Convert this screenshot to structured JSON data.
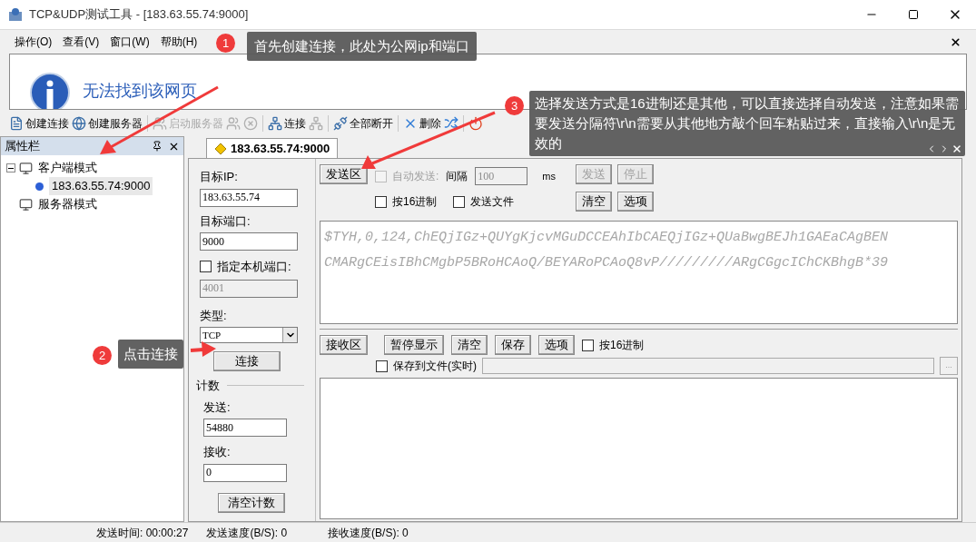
{
  "window": {
    "title": "TCP&UDP测试工具 - [183.63.55.74:9000]"
  },
  "menu": [
    "操作(O)",
    "查看(V)",
    "窗口(W)",
    "帮助(H)"
  ],
  "browser_pane": {
    "message": "无法找到该网页"
  },
  "toolbar": [
    {
      "label": "创建连接",
      "disabled": false
    },
    {
      "label": "创建服务器",
      "disabled": false
    },
    {
      "label": "启动服务器",
      "disabled": true
    },
    {
      "disabled": true
    },
    {
      "disabled": true
    },
    {
      "label": "连接",
      "disabled": false
    },
    {
      "disabled": true
    },
    {
      "label": "全部断开",
      "disabled": false
    },
    {
      "label": "删除",
      "disabled": false
    },
    {
      "disabled": false
    },
    {
      "disabled": false
    }
  ],
  "sidebar": {
    "title": "属性栏",
    "tree": [
      {
        "label": "客户端模式",
        "selected": false,
        "expanded": true,
        "children": [
          {
            "label": "183.63.55.74:9000",
            "selected": true
          }
        ]
      },
      {
        "label": "服务器模式",
        "selected": false
      }
    ]
  },
  "tabs": [
    {
      "label": "183.63.55.74:9000",
      "selected": true
    }
  ],
  "form": [
    {
      "kind": "field",
      "label": "目标IP:",
      "value": "183.63.55.74",
      "disabled": false
    },
    {
      "kind": "field",
      "label": "目标端口:",
      "value": "9000",
      "disabled": false
    },
    {
      "kind": "checkbox",
      "label": "指定本机端口:",
      "checked": false
    },
    {
      "kind": "field",
      "value": "4001",
      "disabled": true
    },
    {
      "kind": "select",
      "label": "类型:",
      "value": "TCP"
    }
  ],
  "connect_button": "连接",
  "counter": {
    "title": "计数",
    "send_label": "发送:",
    "send_value": "54880",
    "recv_label": "接收:",
    "recv_value": "0",
    "clear_button": "清空计数"
  },
  "send_area": {
    "button": "发送区",
    "auto_send": {
      "label": "自动发送:",
      "checked": false,
      "disabled": true
    },
    "interval_label": "间隔",
    "interval_value": "100",
    "interval_unit": "ms",
    "send_button": {
      "label": "发送",
      "disabled": true
    },
    "stop_button": {
      "label": "停止",
      "disabled": true
    },
    "hex": {
      "label": "按16进制",
      "checked": false
    },
    "send_file": {
      "label": "发送文件",
      "checked": false
    },
    "clear_button": "清空",
    "options_button": "选项",
    "lines": [
      "$TYH,0,124,ChEQjIGz+QUYgKjcvMGuDCCEAhIbCAEQjIGz+QUaBwgBEJh1GAEaCAgBEN",
      "CMARgCEisIBhCMgbP5BRoHCAoQ/BEYARoPCAoQ8vP/////////ARgCGgcIChCKBhgB*39"
    ]
  },
  "receive_area": {
    "button": "接收区",
    "buttons": [
      "暂停显示",
      "清空",
      "保存",
      "选项"
    ],
    "hex": {
      "label": "按16进制",
      "checked": false
    },
    "save_to_file": {
      "label": "保存到文件(实时)",
      "checked": false
    },
    "browse_button": "..."
  },
  "status_bar": [
    "发送时间: 00:00:27",
    "发送速度(B/S): 0",
    "接收速度(B/S): 0"
  ],
  "annotations": [
    {
      "number": "1",
      "text": "首先创建连接，此处为公网ip和端口"
    },
    {
      "number": "2",
      "text": "点击连接"
    },
    {
      "number": "3",
      "text": "选择发送方式是16进制还是其他，可以直接选择自动发送，注意如果需要发送分隔符\\r\\n需要从其他地方敲个回车粘贴过来，直接输入\\r\\n是无效的"
    }
  ]
}
